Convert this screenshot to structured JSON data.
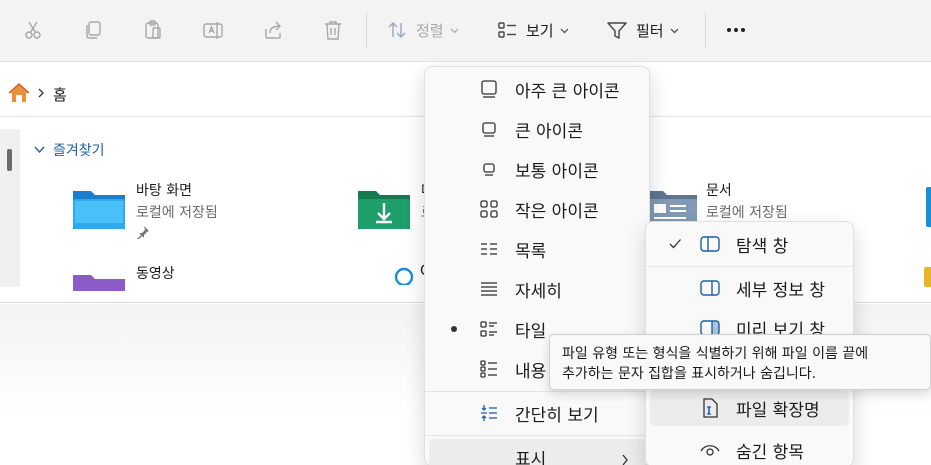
{
  "toolbar": {
    "sort_label": "정렬",
    "view_label": "보기",
    "filter_label": "필터",
    "more_icon": "more-icon"
  },
  "address": {
    "home_label": "홈"
  },
  "favorites": {
    "header": "즐겨찾기",
    "items": [
      {
        "title": "바탕 화면",
        "subtitle": "로컬에 저장됨"
      },
      {
        "title": "다",
        "subtitle": "로"
      },
      {
        "title": "문서",
        "subtitle": "로컬에 저장됨"
      },
      {
        "title": "동영상",
        "subtitle": ""
      },
      {
        "title": "C",
        "subtitle": ""
      }
    ]
  },
  "view_menu": {
    "items": [
      {
        "label": "아주 큰 아이콘"
      },
      {
        "label": "큰 아이콘"
      },
      {
        "label": "보통 아이콘"
      },
      {
        "label": "작은 아이콘"
      },
      {
        "label": "목록"
      },
      {
        "label": "자세히"
      },
      {
        "label": "타일",
        "selected": true
      },
      {
        "label": "내용"
      },
      {
        "label": "간단히 보기"
      },
      {
        "label": "표시"
      }
    ]
  },
  "show_submenu": {
    "items": [
      {
        "label": "탐색 창",
        "checked": true
      },
      {
        "label": "세부 정보 창"
      },
      {
        "label": "미리 보기 창"
      },
      {
        "label": "파일 확장명"
      },
      {
        "label": "숨긴 항목"
      }
    ]
  },
  "tooltip": {
    "line1": "파일 유형 또는 형식을 식별하기 위해 파일 이름 끝에",
    "line2": "추가하는 문자 집합을 표시하거나 숨깁니다."
  },
  "colors": {
    "accent": "#1f5fa8",
    "folder_blue": "#1a8fd8",
    "folder_green": "#1e9e6a",
    "folder_purple": "#8b5cc8"
  }
}
